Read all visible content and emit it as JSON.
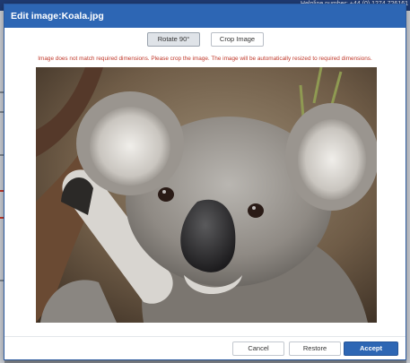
{
  "background": {
    "helpline_text": "Helpline number: +44 (0) 1274 726161"
  },
  "modal": {
    "title": "Edit image:Koala.jpg",
    "toolbar": {
      "rotate_label": "Rotate 90°",
      "crop_label": "Crop Image"
    },
    "warning": "Image does not match required dimensions. Please crop the image. The image will be automatically resized to required dimensions.",
    "footer": {
      "cancel_label": "Cancel",
      "restore_label": "Restore",
      "accept_label": "Accept"
    }
  },
  "colors": {
    "header_blue": "#2d66b4",
    "warning_red": "#c0392b",
    "accept_blue": "#2d66b4"
  }
}
